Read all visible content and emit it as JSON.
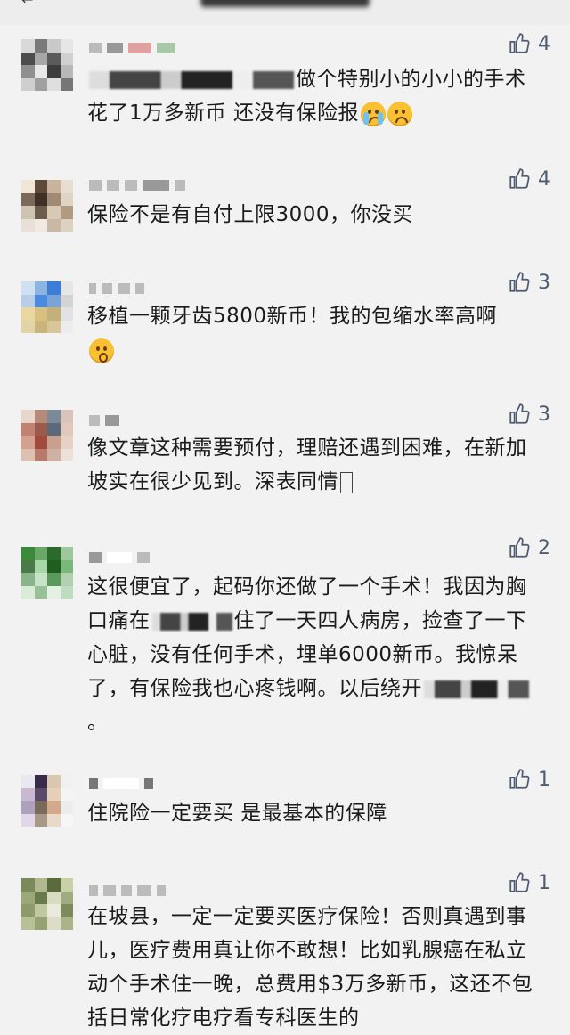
{
  "header": {
    "title_obscured": true
  },
  "comments": [
    {
      "likes": "4",
      "avatar_colors": [
        "#d9d9d9",
        "#7a7a7a",
        "#c9c9c9",
        "#e6e6e6",
        "#4d4d4d",
        "#a7a7a7",
        "#5b5b5b",
        "#d0d0d0",
        "#8f8f8f",
        "#e8e8e8",
        "#3c3c3c",
        "#b8b8b8",
        "#cfcfcf",
        "#a0a0a0",
        "#dedede",
        "#767676"
      ],
      "text": "做个特别小的小小的手术 花了1万多新币 还没有保险报"
    },
    {
      "likes": "4",
      "avatar_colors": [
        "#efe6d8",
        "#5e4a3a",
        "#c9b39a",
        "#e7ddd0",
        "#7b6a5a",
        "#3d3026",
        "#a08a74",
        "#e0d4c4",
        "#cfc3b3",
        "#6d5c4c",
        "#d8c8b4",
        "#b09a82",
        "#e8e0d6",
        "#f0eae2",
        "#c8b8a4",
        "#ddd2c2"
      ],
      "text": "保险不是有自付上限3000，你没买"
    },
    {
      "likes": "3",
      "avatar_colors": [
        "#cfe0f2",
        "#8cb4e0",
        "#3d7dd8",
        "#e6e6e6",
        "#b7cde8",
        "#4a8ae0",
        "#7aa4d8",
        "#d4d4d4",
        "#e8d8a0",
        "#d8c080",
        "#c4b078",
        "#e2e2e2",
        "#e0d4a8",
        "#cbb47c",
        "#d6c69a",
        "#ececec"
      ],
      "text": "移植一颗牙齿5800新币！我的包缩水率高啊"
    },
    {
      "likes": "3",
      "avatar_colors": [
        "#e8d6cc",
        "#b58a78",
        "#7a8a96",
        "#d8c4ba",
        "#c28272",
        "#9a5a4c",
        "#5a6a7a",
        "#e0c8bc",
        "#d4a090",
        "#a04a3c",
        "#c8a090",
        "#e8d0c4",
        "#dcc0b2",
        "#b87a6a",
        "#d0b0a2",
        "#ece0d8"
      ],
      "text": "像文章这种需要预付，理赔还遇到困难，在新加坡实在很少见到。深表同情"
    },
    {
      "likes": "2",
      "avatar_colors": [
        "#3a8a3a",
        "#6aa86a",
        "#2a6a2a",
        "#9cc89c",
        "#4a7a4a",
        "#a8d8a8",
        "#1e5e1e",
        "#7ab87a",
        "#8ab48a",
        "#c8e4c8",
        "#5a9a5a",
        "#b0d0b0",
        "#d8ecd8",
        "#9ac09a",
        "#e4f0e4",
        "#c0dcc0"
      ],
      "text_line1": "这很便宜了，起码你还做了一个手术！我因为胸口痛在",
      "text_line2": "住了一天四人病房，捡查了一下心脏，没有任何手术，埋单6000新币。我惊呆了，有保险我也心疼钱啊。以后绕开",
      "text_end": "。"
    },
    {
      "likes": "1",
      "avatar_colors": [
        "#e8e8f0",
        "#3a2a4a",
        "#d8c8b0",
        "#f0f0f0",
        "#c8b8d0",
        "#5a4a6a",
        "#e8d0b8",
        "#f4f4f4",
        "#b0a0c0",
        "#7a6a5a",
        "#d4a88a",
        "#ececec",
        "#e0d8e8",
        "#a89888",
        "#ead8c8",
        "#f6f6f6"
      ],
      "text": "住院险一定要买 是最基本的保障"
    },
    {
      "likes": "1",
      "avatar_colors": [
        "#7a8a5a",
        "#b0b890",
        "#5a6a3a",
        "#c8d0a8",
        "#9aa87a",
        "#6a7a4a",
        "#d8dcc0",
        "#a0ac80",
        "#8c9a6c",
        "#c0c8a0",
        "#eaeadc",
        "#7c8a5c",
        "#b8c098",
        "#94a274",
        "#dcdcc8",
        "#aab488"
      ],
      "text": "在坡县，一定一定要买医疗保险！否则真遇到事儿，医疗费用真让你不敢想！比如乳腺癌在私立动个手术住一晚，总费用$3万多新币，这还不包括日常化疗电疗看专科医生的"
    }
  ]
}
